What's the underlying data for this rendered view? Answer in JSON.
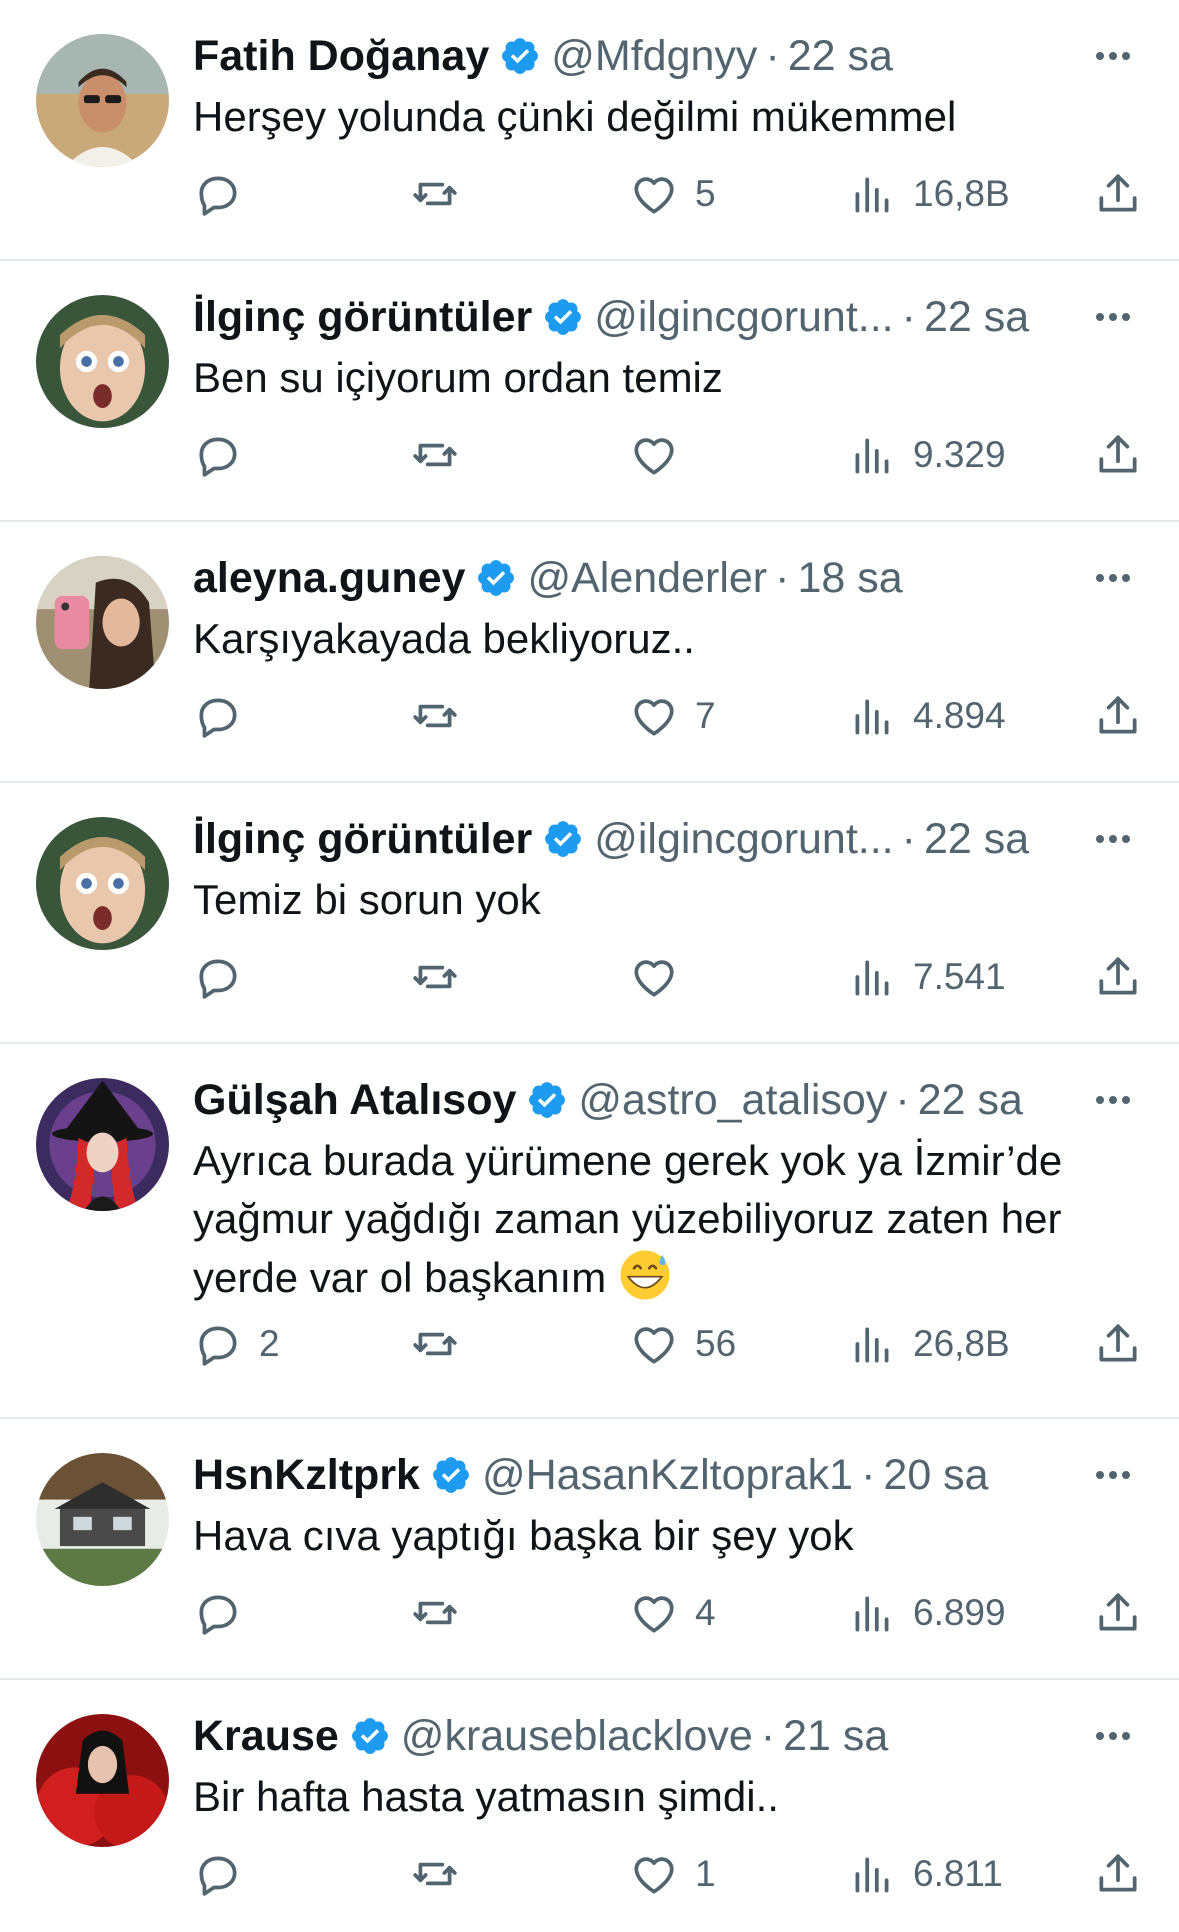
{
  "colors": {
    "text": "#0f1419",
    "muted": "#536471",
    "verified": "#1d9bf0",
    "divider": "#e6e9ec"
  },
  "tweets": [
    {
      "name": "Fatih Doğanay",
      "handle": "@Mfdgnyy",
      "dot": "·",
      "time": "22 sa",
      "text": "Herşey yolunda çünki değilmi mükemmel",
      "reply_count": "",
      "like_count": "5",
      "views": "16,8B",
      "avatar": "man-sunglasses"
    },
    {
      "name": "İlginç görüntüler",
      "handle": "@ilgincgorunt...",
      "dot": "·",
      "time": "22 sa",
      "text": "Ben su içiyorum ordan temiz",
      "reply_count": "",
      "like_count": "",
      "views": "9.329",
      "avatar": "surprised-face"
    },
    {
      "name": "aleyna.guney",
      "handle": "@Alenderler",
      "dot": "·",
      "time": "18 sa",
      "text": "Karşıyakayada bekliyoruz..",
      "reply_count": "",
      "like_count": "7",
      "views": "4.894",
      "avatar": "woman-selfie"
    },
    {
      "name": "İlginç görüntüler",
      "handle": "@ilgincgorunt...",
      "dot": "·",
      "time": "22 sa",
      "text": "Temiz bi sorun yok",
      "reply_count": "",
      "like_count": "",
      "views": "7.541",
      "avatar": "surprised-face"
    },
    {
      "name": "Gülşah Atalısoy",
      "handle": "@astro_atalisoy",
      "dot": "·",
      "time": "22 sa",
      "text": "Ayrıca burada yürümene gerek yok ya İzmir’de yağmur yağdığı zaman yüzebiliyoruz zaten her yerde var ol başkanım",
      "reply_count": "2",
      "like_count": "56",
      "views": "26,8B",
      "avatar": "witch",
      "emoji": "grinning-sweat-emoji"
    },
    {
      "name": "HsnKzltprk",
      "handle": "@HasanKzltoprak1",
      "dot": "·",
      "time": "20 sa",
      "text": "Hava cıva yaptığı başka bir şey yok",
      "reply_count": "",
      "like_count": "4",
      "views": "6.899",
      "avatar": "house"
    },
    {
      "name": "Krause",
      "handle": "@krauseblacklove",
      "dot": "·",
      "time": "21 sa",
      "text": "Bir hafta hasta yatmasın şimdi..",
      "reply_count": "",
      "like_count": "1",
      "views": "6.811",
      "avatar": "woman-red"
    }
  ]
}
